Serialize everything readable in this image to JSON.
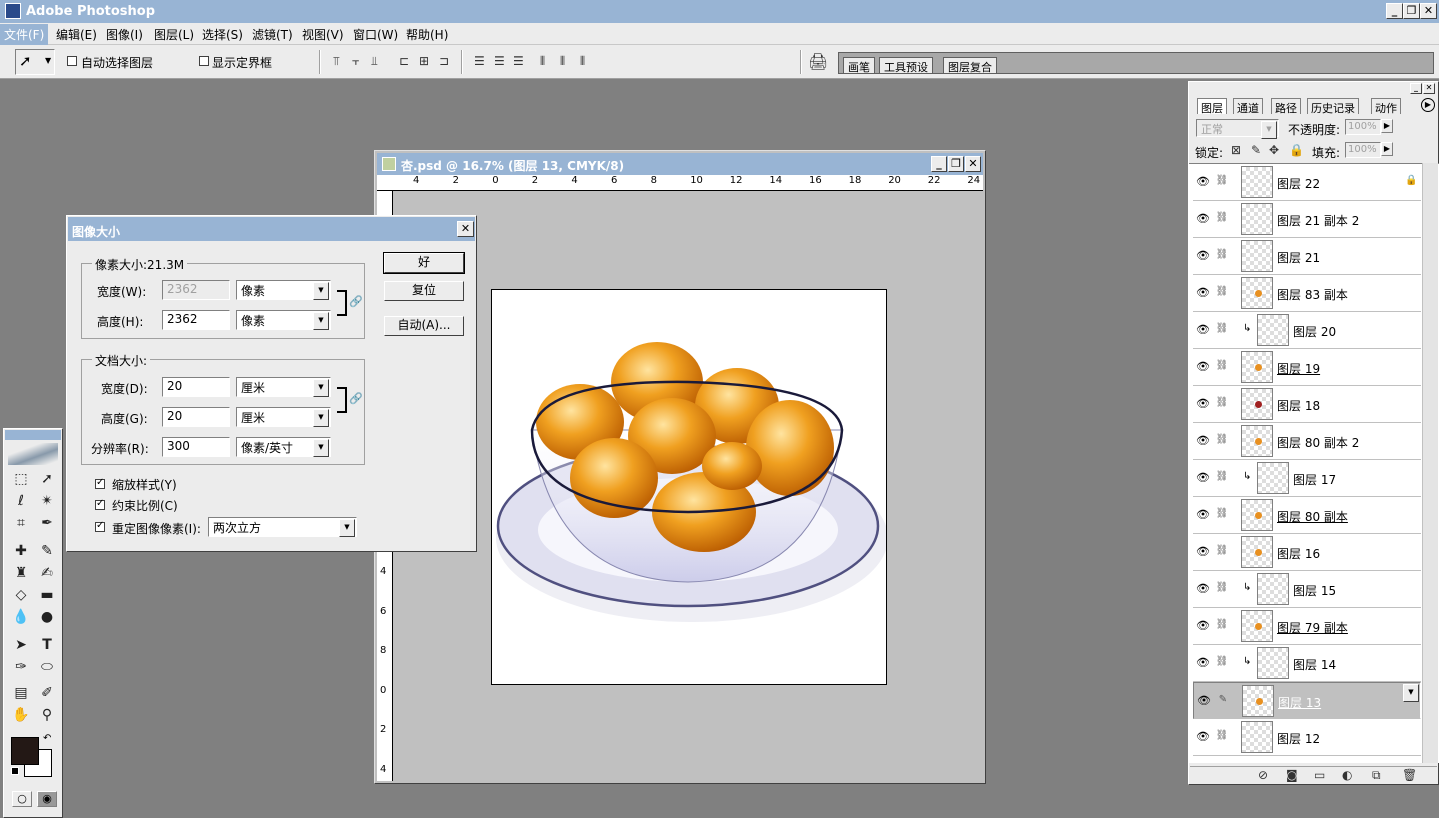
{
  "app": {
    "title": "Adobe Photoshop"
  },
  "window_buttons": {
    "minimize": "_",
    "restore": "❐",
    "close": "✕"
  },
  "menu": [
    "文件(F)",
    "编辑(E)",
    "图像(I)",
    "图层(L)",
    "选择(S)",
    "滤镜(T)",
    "视图(V)",
    "窗口(W)",
    "帮助(H)"
  ],
  "options": {
    "auto_select_label": "自动选择图层",
    "auto_select_checked": false,
    "show_bounds_label": "显示定界框",
    "show_bounds_checked": false,
    "well_tabs": [
      "画笔",
      "工具预设",
      "图层复合"
    ]
  },
  "document": {
    "title": "杏.psd @ 16.7% (图层 13, CMYK/8)",
    "h_ruler_ticks": [
      "4",
      "2",
      "0",
      "2",
      "4",
      "6",
      "8",
      "10",
      "12",
      "14",
      "16",
      "18",
      "20",
      "22",
      "24"
    ],
    "v_ruler_ticks": [
      "4",
      "6",
      "8",
      "0",
      "2",
      "4"
    ]
  },
  "dialog": {
    "title": "图像大小",
    "pixel_dims_label": "像素大小:21.3M",
    "width_label": "宽度(W):",
    "width_value": "2362",
    "width_unit": "像素",
    "height_label": "高度(H):",
    "height_value": "2362",
    "height_unit": "像素",
    "doc_size_label": "文档大小:",
    "doc_width_label": "宽度(D):",
    "doc_width_value": "20",
    "doc_width_unit": "厘米",
    "doc_height_label": "高度(G):",
    "doc_height_value": "20",
    "doc_height_unit": "厘米",
    "resolution_label": "分辨率(R):",
    "resolution_value": "300",
    "resolution_unit": "像素/英寸",
    "scale_styles_label": "缩放样式(Y)",
    "constrain_label": "约束比例(C)",
    "resample_label": "重定图像像素(I):",
    "resample_method": "两次立方",
    "ok_label": "好",
    "reset_label": "复位",
    "auto_label": "自动(A)..."
  },
  "layers_panel": {
    "tabs": [
      "图层",
      "通道",
      "路径",
      "历史记录",
      "动作"
    ],
    "blend_mode": "正常",
    "opacity_label": "不透明度:",
    "opacity_value": "100%",
    "lock_label": "锁定:",
    "fill_label": "填充:",
    "fill_value": "100%",
    "layers": [
      {
        "name": "图层 22",
        "clip": false,
        "underline": false,
        "selected": false,
        "locked": true,
        "dot": ""
      },
      {
        "name": "图层 21 副本 2",
        "clip": false,
        "underline": false,
        "selected": false,
        "locked": false,
        "dot": ""
      },
      {
        "name": "图层 21",
        "clip": false,
        "underline": false,
        "selected": false,
        "locked": false,
        "dot": ""
      },
      {
        "name": "图层 83 副本",
        "clip": false,
        "underline": false,
        "selected": false,
        "locked": false,
        "dot": "#e89020"
      },
      {
        "name": "图层 20",
        "clip": true,
        "underline": false,
        "selected": false,
        "locked": false,
        "dot": ""
      },
      {
        "name": "图层 19",
        "clip": false,
        "underline": true,
        "selected": false,
        "locked": false,
        "dot": "#e89020"
      },
      {
        "name": "图层 18",
        "clip": false,
        "underline": false,
        "selected": false,
        "locked": false,
        "dot": "#a02020"
      },
      {
        "name": "图层 80 副本 2",
        "clip": false,
        "underline": false,
        "selected": false,
        "locked": false,
        "dot": "#e89020"
      },
      {
        "name": "图层 17",
        "clip": true,
        "underline": false,
        "selected": false,
        "locked": false,
        "dot": ""
      },
      {
        "name": "图层 80 副本",
        "clip": false,
        "underline": true,
        "selected": false,
        "locked": false,
        "dot": "#e89020"
      },
      {
        "name": "图层 16",
        "clip": false,
        "underline": false,
        "selected": false,
        "locked": false,
        "dot": "#e89020"
      },
      {
        "name": "图层 15",
        "clip": true,
        "underline": false,
        "selected": false,
        "locked": false,
        "dot": ""
      },
      {
        "name": "图层 79 副本",
        "clip": false,
        "underline": true,
        "selected": false,
        "locked": false,
        "dot": "#e89020"
      },
      {
        "name": "图层 14",
        "clip": true,
        "underline": false,
        "selected": false,
        "locked": false,
        "dot": ""
      },
      {
        "name": "图层 13",
        "clip": false,
        "underline": true,
        "selected": true,
        "locked": false,
        "dot": "#e89020"
      },
      {
        "name": "图层 12",
        "clip": false,
        "underline": false,
        "selected": false,
        "locked": false,
        "dot": ""
      }
    ]
  },
  "colors": {
    "title_bar": "#98b4d4",
    "workspace": "#808080",
    "foreground": "#231815",
    "background": "#ffffff",
    "apricot": "#f0a020"
  }
}
